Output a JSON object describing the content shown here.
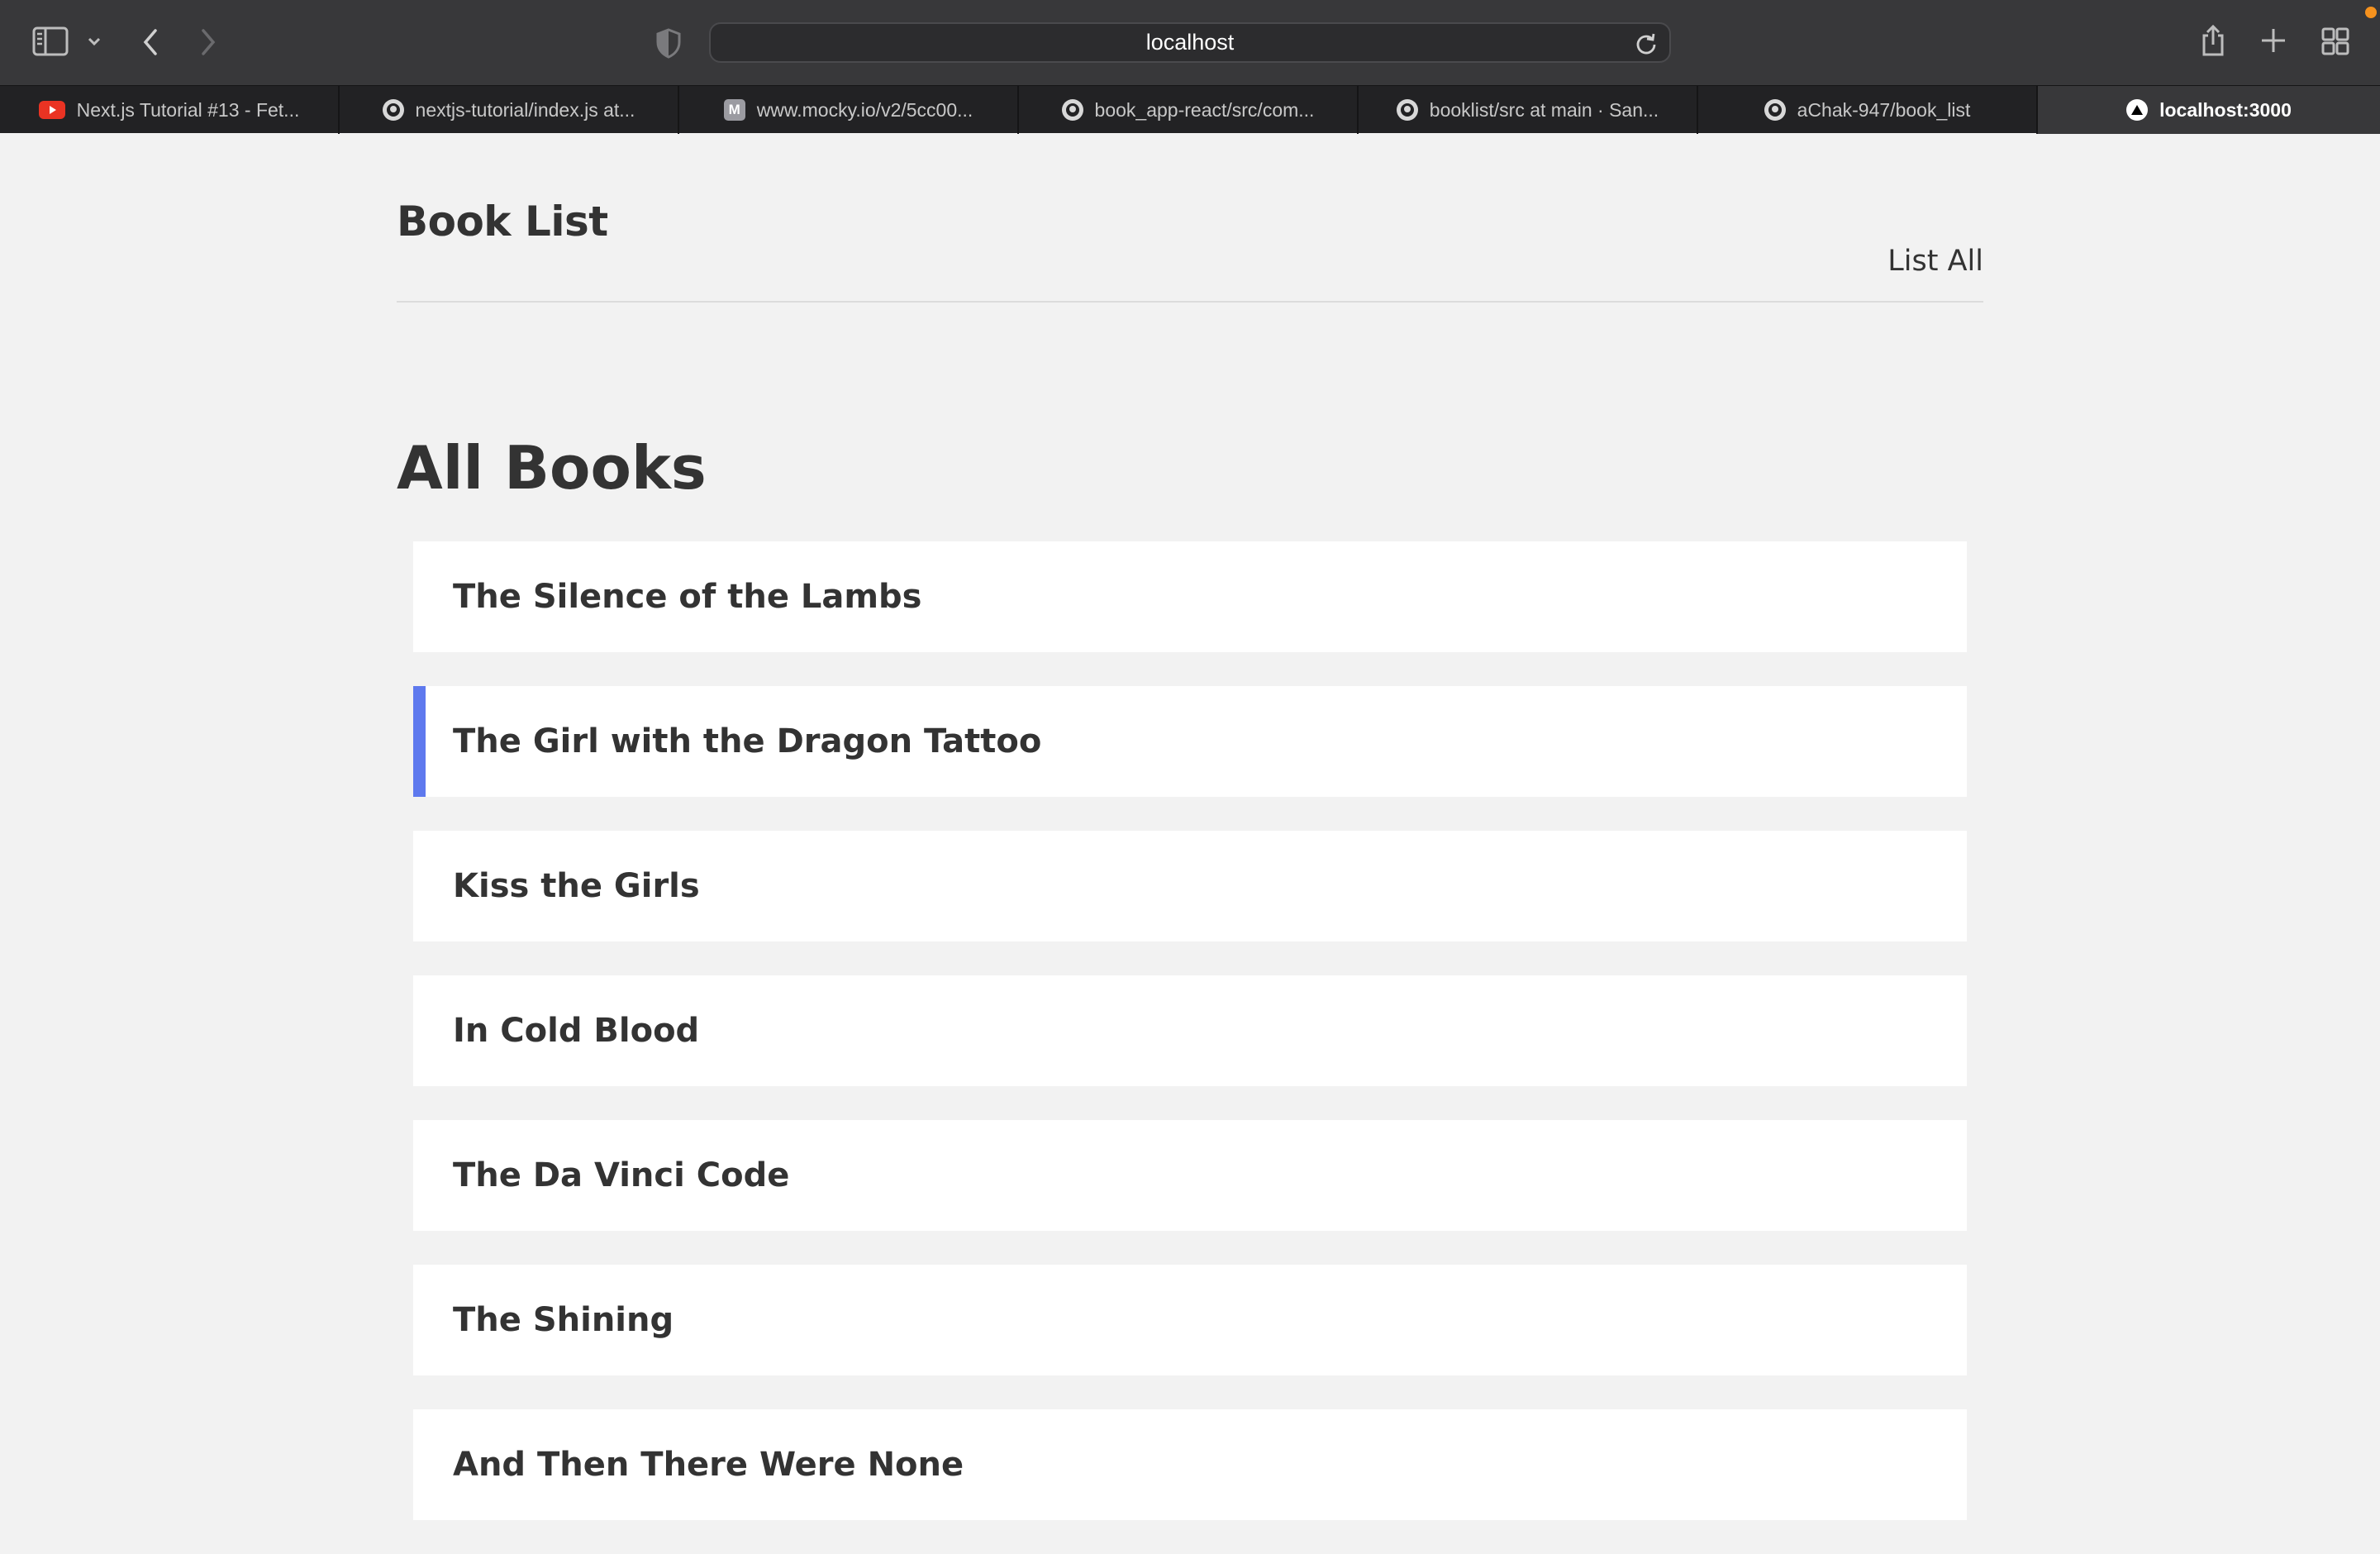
{
  "browser": {
    "url": "localhost",
    "tabs": [
      {
        "label": "Next.js Tutorial #13 - Fet...",
        "favicon": "youtube-favicon"
      },
      {
        "label": "nextjs-tutorial/index.js at...",
        "favicon": "github-favicon"
      },
      {
        "label": "www.mocky.io/v2/5cc00...",
        "favicon": "mocky-favicon",
        "favicon_letter": "M"
      },
      {
        "label": "book_app-react/src/com...",
        "favicon": "github-favicon"
      },
      {
        "label": "booklist/src at main · San...",
        "favicon": "github-favicon"
      },
      {
        "label": "aChak-947/book_list",
        "favicon": "github-favicon"
      },
      {
        "label": "localhost:3000",
        "favicon": "vercel-favicon",
        "active": true
      }
    ]
  },
  "header": {
    "site_title": "Book List",
    "nav_link": "List All"
  },
  "main": {
    "heading": "All Books",
    "books": [
      {
        "title": "The Silence of the Lambs"
      },
      {
        "title": "The Girl with the Dragon Tattoo",
        "hovered": true
      },
      {
        "title": "Kiss the Girls"
      },
      {
        "title": "In Cold Blood"
      },
      {
        "title": "The Da Vinci Code"
      },
      {
        "title": "The Shining"
      },
      {
        "title": "And Then There Were None"
      }
    ]
  },
  "colors": {
    "page_background": "#f2f2f2",
    "card_background": "#ffffff",
    "hover_accent": "#5e79ee",
    "text": "#333333",
    "toolbar": "#38383a",
    "tabbar": "#222224"
  }
}
